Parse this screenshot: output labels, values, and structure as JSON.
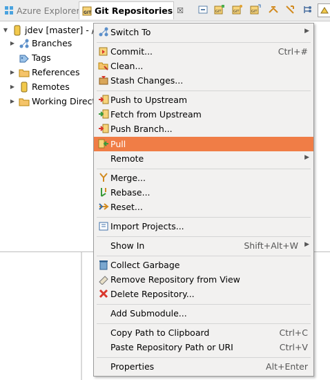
{
  "tabs": [
    {
      "label": "Azure Explorer",
      "icon": "azure-window-icon",
      "active": false
    },
    {
      "label": "Git Repositories",
      "icon": "git-repositories-icon",
      "active": true,
      "close": "☒"
    }
  ],
  "toolbar": {
    "icons": [
      "collapse-all-icon",
      "add-repository-icon",
      "clone-repository-icon",
      "create-repository-icon",
      "link-with-selection-icon",
      "link-with-editor-icon",
      "filter-icon",
      "view-menu-icon"
    ]
  },
  "repo": {
    "label": "jdev [master] - /h"
  },
  "tree": [
    {
      "label": "Branches",
      "icon": "branches-icon",
      "expandable": true
    },
    {
      "label": "Tags",
      "icon": "tags-icon",
      "expandable": false
    },
    {
      "label": "References",
      "icon": "folder-icon",
      "expandable": true
    },
    {
      "label": "Remotes",
      "icon": "remotes-icon",
      "expandable": true
    },
    {
      "label": "Working Directo",
      "icon": "folder-icon",
      "expandable": true
    }
  ],
  "menu": [
    {
      "label": "Switch To",
      "icon": "switch-to-icon",
      "shortcut": "",
      "submenu": true
    },
    {
      "label": "Commit...",
      "icon": "commit-icon",
      "shortcut": "Ctrl+#",
      "submenu": false
    },
    {
      "label": "Clean...",
      "icon": "clean-icon",
      "shortcut": "",
      "submenu": false
    },
    {
      "label": "Stash Changes...",
      "icon": "stash-icon",
      "shortcut": "",
      "submenu": false
    },
    {
      "label": "Push to Upstream",
      "icon": "push-upstream-icon",
      "shortcut": "",
      "submenu": false
    },
    {
      "label": "Fetch from Upstream",
      "icon": "fetch-upstream-icon",
      "shortcut": "",
      "submenu": false
    },
    {
      "label": "Push Branch...",
      "icon": "push-branch-icon",
      "shortcut": "",
      "submenu": false
    },
    {
      "label": "Pull",
      "icon": "pull-icon",
      "shortcut": "",
      "submenu": false,
      "selected": true
    },
    {
      "label": "Remote",
      "icon": "",
      "shortcut": "",
      "submenu": true
    },
    {
      "label": "Merge...",
      "icon": "merge-icon",
      "shortcut": "",
      "submenu": false
    },
    {
      "label": "Rebase...",
      "icon": "rebase-icon",
      "shortcut": "",
      "submenu": false
    },
    {
      "label": "Reset...",
      "icon": "reset-icon",
      "shortcut": "",
      "submenu": false
    },
    {
      "label": "Import Projects...",
      "icon": "import-projects-icon",
      "shortcut": "",
      "submenu": false
    },
    {
      "label": "Show In",
      "icon": "",
      "shortcut": "Shift+Alt+W",
      "submenu": true
    },
    {
      "label": "Collect Garbage",
      "icon": "garbage-icon",
      "shortcut": "",
      "submenu": false
    },
    {
      "label": "Remove Repository from View",
      "icon": "remove-repository-icon",
      "shortcut": "",
      "submenu": false
    },
    {
      "label": "Delete Repository...",
      "icon": "delete-icon",
      "shortcut": "",
      "submenu": false
    },
    {
      "label": "Add Submodule...",
      "icon": "",
      "shortcut": "",
      "submenu": false
    },
    {
      "label": "Copy Path to Clipboard",
      "icon": "",
      "shortcut": "Ctrl+C",
      "submenu": false
    },
    {
      "label": "Paste Repository Path or URI",
      "icon": "",
      "shortcut": "Ctrl+V",
      "submenu": false
    },
    {
      "label": "Properties",
      "icon": "",
      "shortcut": "Alt+Enter",
      "submenu": false
    }
  ],
  "colors": {
    "selection": "#f07d46",
    "menu_bg": "#f2f1f0"
  }
}
